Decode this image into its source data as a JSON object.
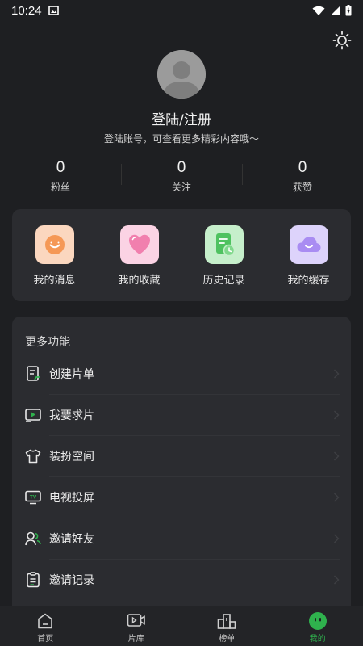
{
  "status_bar": {
    "time": "10:24"
  },
  "profile": {
    "login_title": "登陆/注册",
    "login_subtitle": "登陆账号，可查看更多精彩内容哦～"
  },
  "stats": [
    {
      "value": "0",
      "label": "粉丝"
    },
    {
      "value": "0",
      "label": "关注"
    },
    {
      "value": "0",
      "label": "获赞"
    }
  ],
  "quick_actions": [
    {
      "label": "我的消息",
      "icon": "smile-face-icon",
      "color": "#f6a06a"
    },
    {
      "label": "我的收藏",
      "icon": "heart-icon",
      "color": "#f07aa8"
    },
    {
      "label": "历史记录",
      "icon": "history-doc-icon",
      "color": "#58c86a"
    },
    {
      "label": "我的缓存",
      "icon": "cloud-icon",
      "color": "#a48cf0"
    }
  ],
  "more_section": {
    "title": "更多功能",
    "items": [
      {
        "label": "创建片单",
        "icon": "create-list-icon"
      },
      {
        "label": "我要求片",
        "icon": "request-video-icon"
      },
      {
        "label": "装扮空间",
        "icon": "tshirt-icon"
      },
      {
        "label": "电视投屏",
        "icon": "tv-cast-icon"
      },
      {
        "label": "邀请好友",
        "icon": "invite-friend-icon"
      },
      {
        "label": "邀请记录",
        "icon": "invite-record-icon"
      }
    ]
  },
  "tabs": [
    {
      "label": "首页",
      "icon": "home-icon"
    },
    {
      "label": "片库",
      "icon": "video-library-icon"
    },
    {
      "label": "榜单",
      "icon": "ranking-icon"
    },
    {
      "label": "我的",
      "icon": "profile-face-icon",
      "active": true
    }
  ],
  "colors": {
    "accent": "#2fb14d",
    "background": "#1e1f22",
    "card": "#2b2c30"
  }
}
